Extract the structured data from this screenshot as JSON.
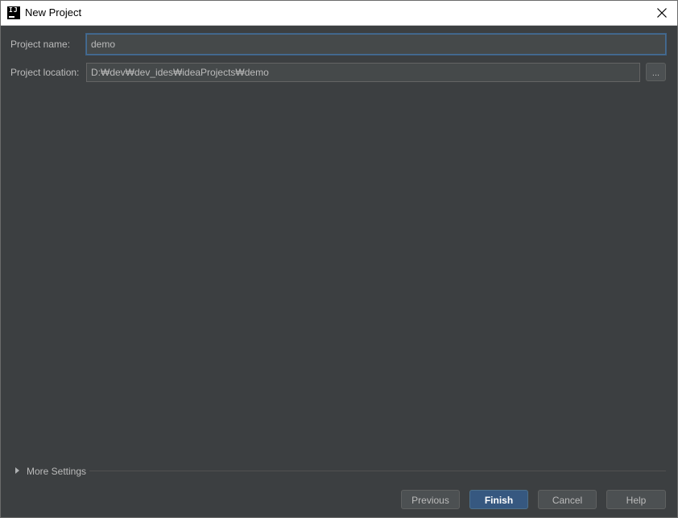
{
  "window": {
    "title": "New Project",
    "app_icon": "intellij-idea-icon"
  },
  "form": {
    "project_name_label": "Project name:",
    "project_name_value": "demo",
    "project_location_label": "Project location:",
    "project_location_value": "D:₩dev₩dev_ides₩ideaProjects₩demo",
    "browse_label": "..."
  },
  "more_settings": {
    "label": "More Settings",
    "expanded": false
  },
  "footer": {
    "previous_label": "Previous",
    "finish_label": "Finish",
    "cancel_label": "Cancel",
    "help_label": "Help"
  },
  "colors": {
    "background": "#3c3f41",
    "input_background": "#45494a",
    "primary_button": "#365880",
    "text": "#bbbbbb",
    "focus_border": "#466d94"
  }
}
